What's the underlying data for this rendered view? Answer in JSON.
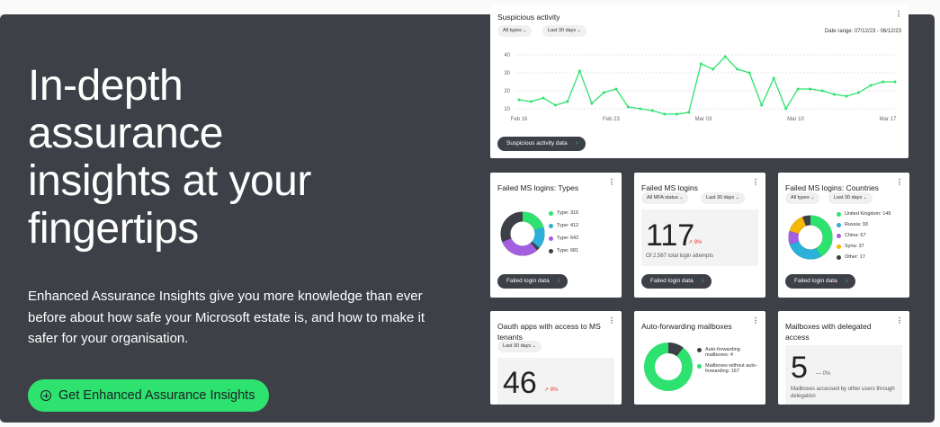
{
  "hero": {
    "headline": "In-depth\nassurance\ninsights at your\nfingertips",
    "description": "Enhanced Assurance Insights give you more knowledge than ever before about how safe your Microsoft estate is, and how to make it safer for your organisation.",
    "cta_label": "Get Enhanced Assurance Insights"
  },
  "colors": {
    "accent": "#2ee26f",
    "hero_bg": "#3e4047",
    "purple": "#a35fe0",
    "blue": "#2bb0d9",
    "yellow": "#f5b700",
    "red_delta": "#e03b3b"
  },
  "suspicious": {
    "title": "Suspicious activity",
    "filter_types": "All types",
    "filter_period": "Last 30 days",
    "date_range": "Date range: 07/12/23 - 06/12/23",
    "button": "Suspicious activity data",
    "yticks": [
      "40",
      "30",
      "20",
      "10"
    ],
    "xticks": [
      "Feb 16",
      "Feb 23",
      "Mar 03",
      "Mar 10",
      "Mar 17"
    ]
  },
  "chart_data": {
    "type": "line",
    "title": "Suspicious activity",
    "xlabel": "",
    "ylabel": "",
    "ylim": [
      5,
      45
    ],
    "grid": true,
    "legend": "none",
    "series": [
      {
        "values": [
          15,
          14,
          16,
          12,
          14,
          31,
          13,
          19,
          21,
          11,
          10,
          9,
          7,
          7,
          8,
          35,
          32,
          39,
          32,
          30,
          12,
          27,
          10,
          21,
          21,
          20,
          18,
          17,
          19,
          23,
          25,
          25
        ]
      }
    ]
  },
  "types_card": {
    "title": "Failed MS logins: Types",
    "legend": [
      {
        "label": "Type: 316",
        "color": "#2ee26f"
      },
      {
        "label": "Type: 412",
        "color": "#2bb0d9"
      },
      {
        "label": "Type: 642",
        "color": "#a35fe0"
      },
      {
        "label": "Type: 681",
        "color": "#3e4047"
      }
    ],
    "button": "Failed login data"
  },
  "logins_card": {
    "title": "Failed MS logins",
    "filter_status": "All MFA status",
    "filter_period": "Last 30 days",
    "value": "117",
    "delta": "↗ 8%",
    "subtext": "Of 2,567 total login attempts",
    "button": "Failed login data"
  },
  "countries_card": {
    "title": "Failed MS logins: Countries",
    "filter_types": "All types",
    "filter_period": "Last 30 days",
    "legend": [
      {
        "label": "United Kingdom: 149",
        "color": "#2ee26f"
      },
      {
        "label": "Russia: 93",
        "color": "#2bb0d9"
      },
      {
        "label": "China: 67",
        "color": "#a35fe0"
      },
      {
        "label": "Syria: 37",
        "color": "#f5b700"
      },
      {
        "label": "Other: 17",
        "color": "#3e4047"
      }
    ],
    "button": "Failed login data"
  },
  "oauth_card": {
    "title": "Oauth apps with access to MS tenants",
    "filter_period": "Last 30 days",
    "value": "46",
    "delta": "↗ 8%"
  },
  "forwarding_card": {
    "title": "Auto-forwarding mailboxes",
    "legend": [
      {
        "label": "Auto-forwarding mailboxes: 4",
        "color": "#3e4047"
      },
      {
        "label": "Mailboxes without auto-forwarding: 167",
        "color": "#2ee26f"
      }
    ]
  },
  "delegated_card": {
    "title": "Mailboxes with delegated access",
    "value": "5",
    "delta": "— 0%",
    "subtext": "Mailboxes accessed by other users through delegation"
  }
}
